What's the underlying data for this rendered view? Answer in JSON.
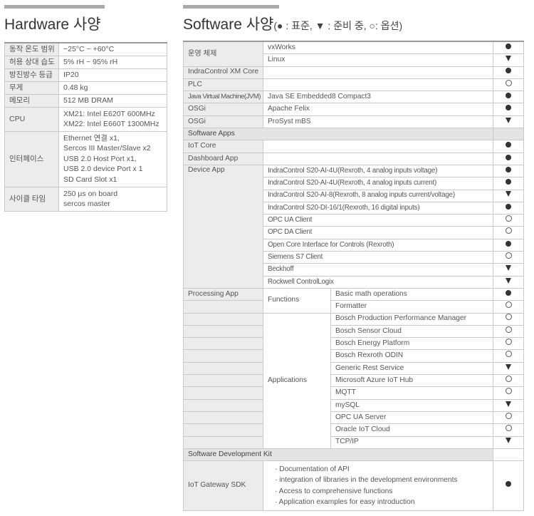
{
  "hardware": {
    "title": "Hardware 사양",
    "rows": [
      {
        "label": "동작 온도 범위",
        "lines": [
          "−25°C ~ +60°C"
        ]
      },
      {
        "label": "허용 상대 습도",
        "lines": [
          "5% rH ~ 95% rH"
        ]
      },
      {
        "label": "방진방수 등급",
        "lines": [
          "IP20"
        ]
      },
      {
        "label": "무게",
        "lines": [
          "0.48 kg"
        ]
      },
      {
        "label": "메모리",
        "lines": [
          "512 MB DRAM"
        ]
      },
      {
        "label": "CPU",
        "lines": [
          "XM21: Intel E620T 600MHz",
          "XM22: Intel E660T 1300MHz"
        ]
      },
      {
        "label": "인터페이스",
        "lines": [
          "Ethernet 연결 x1,",
          "Sercos III Master/Slave x2",
          "USB 2.0 Host Port x1,",
          "USB 2.0 device Port x 1",
          "SD Card Slot x1"
        ]
      },
      {
        "label": "사이클 타임",
        "lines": [
          "250 µs on board",
          "sercos master"
        ]
      }
    ]
  },
  "software": {
    "title": "Software 사양",
    "legend": "(● : 표준, ▼ : 준비 중, ○: 옵션)",
    "symbols": {
      "standard": "●",
      "preparing": "▼",
      "option": "○"
    },
    "os_label": "운영 체제",
    "os_items": [
      {
        "name": "vxWorks",
        "sym": "standard"
      },
      {
        "name": "Linux",
        "sym": "preparing"
      }
    ],
    "indracontrol": {
      "label": "IndraControl XM Core",
      "sym": "standard"
    },
    "plc": {
      "label": "PLC",
      "sym": "option"
    },
    "jvm": {
      "label": "Java Virtual Machine(JVM)",
      "value": "Java SE Embedded8 Compact3",
      "sym": "standard"
    },
    "osgi_rows": [
      {
        "label": "OSGi",
        "value": "Apache Felix",
        "sym": "standard"
      },
      {
        "label": "OSGi",
        "value": "ProSyst mBS",
        "sym": "preparing"
      }
    ],
    "apps_section": "Software Apps",
    "iot_core": {
      "label": "IoT Core",
      "sym": "standard"
    },
    "dashboard": {
      "label": "Dashboard App",
      "sym": "standard"
    },
    "device_app_label": "Device App",
    "device_items": [
      {
        "name": "IndraControl S20-AI-4U(Rexroth, 4 analog inputs voltage)",
        "sym": "standard"
      },
      {
        "name": "IndraControl S20-AI-4U(Rexroth, 4 analog inputs current)",
        "sym": "standard"
      },
      {
        "name": "IndraControl S20-AI-8(Rexroth, 8 analog inputs current/voltage)",
        "sym": "preparing"
      },
      {
        "name": "IndraControl S20-DI-16/1(Rexroth, 16 digital inputs)",
        "sym": "standard"
      },
      {
        "name": "OPC UA Client",
        "sym": "option"
      },
      {
        "name": "OPC DA Client",
        "sym": "option"
      },
      {
        "name": "Open Core Interface for Controls (Rexroth)",
        "sym": "standard"
      },
      {
        "name": "Siemens S7 Client",
        "sym": "option"
      },
      {
        "name": "Beckhoff",
        "sym": "preparing"
      },
      {
        "name": "Rockwell ControlLogix",
        "sym": "preparing"
      }
    ],
    "processing_label": "Processing App",
    "functions_label": "Functions",
    "functions_items": [
      {
        "name": "Basic math operations",
        "sym": "standard"
      },
      {
        "name": "Formatter",
        "sym": "option"
      }
    ],
    "applications_label": "Applications",
    "applications_items": [
      {
        "name": "Bosch Production Performance Manager",
        "sym": "option"
      },
      {
        "name": "Bosch Sensor Cloud",
        "sym": "option"
      },
      {
        "name": "Bosch Energy Platform",
        "sym": "option"
      },
      {
        "name": "Bosch Rexroth ODIN",
        "sym": "option"
      },
      {
        "name": "Generic Rest Service",
        "sym": "preparing"
      },
      {
        "name": "Microsoft Azure IoT Hub",
        "sym": "option"
      },
      {
        "name": "MQTT",
        "sym": "option"
      },
      {
        "name": "mySQL",
        "sym": "preparing"
      },
      {
        "name": "OPC UA Server",
        "sym": "option"
      },
      {
        "name": "Oracle IoT Cloud",
        "sym": "option"
      },
      {
        "name": "TCP/IP",
        "sym": "preparing"
      }
    ],
    "sdk_section": "Software Development Kit",
    "sdk_label": "IoT Gateway SDK",
    "sdk_lines": [
      "· Documentation of API",
      "· integration of libraries in the development environments",
      "· Access to comprehensive functions",
      "· Application examples for easy introduction"
    ],
    "sdk_sym": "standard"
  }
}
